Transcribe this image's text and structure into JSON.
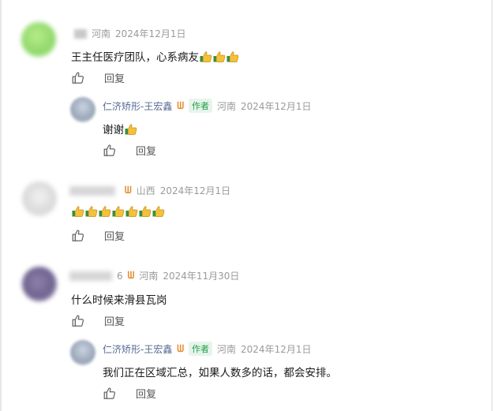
{
  "comments": [
    {
      "user": "",
      "region": "河南",
      "date": "2024年12月1日",
      "text": "王主任医疗团队，心系病友",
      "thumbs": 3,
      "reply_label": "回复",
      "replies": [
        {
          "user": "仁济矫形-王宏鑫",
          "author_badge": "作者",
          "region": "河南",
          "date": "2024年12月1日",
          "text": "谢谢",
          "thumbs": 1,
          "reply_label": "回复"
        }
      ]
    },
    {
      "user": "",
      "region": "山西",
      "date": "2024年12月1日",
      "text": "",
      "thumbs": 7,
      "reply_label": "回复"
    },
    {
      "user": "6",
      "region": "河南",
      "date": "2024年11月30日",
      "text": "什么时候来滑县瓦岗",
      "thumbs": 0,
      "reply_label": "回复",
      "replies": [
        {
          "user": "仁济矫形-王宏鑫",
          "author_badge": "作者",
          "region": "河南",
          "date": "2024年12月1日",
          "text": "我们正在区域汇总，如果人数多的话，都会安排。",
          "thumbs": 0,
          "reply_label": "回复"
        }
      ]
    }
  ],
  "colors": {
    "accent_name": "#576b95",
    "author_badge": "#1f9f4a",
    "badge_w": "#e58a2e"
  }
}
